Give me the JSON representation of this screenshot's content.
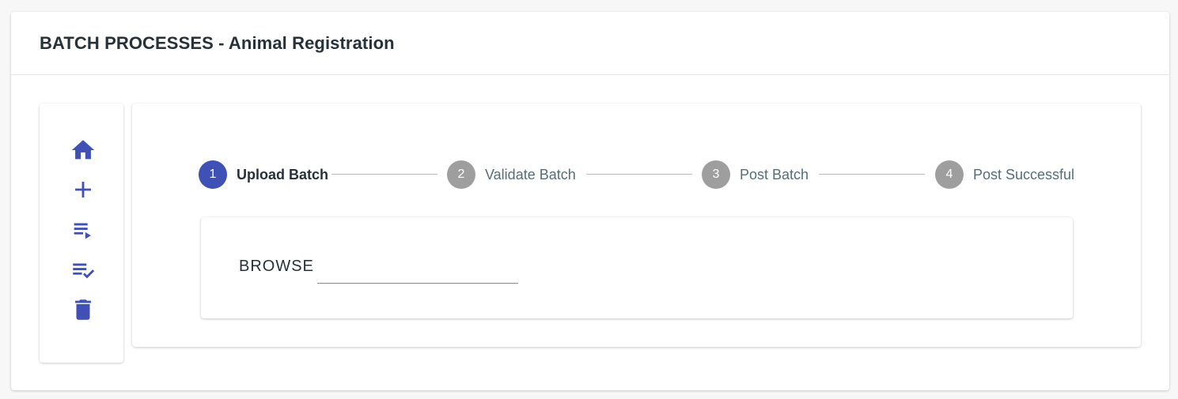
{
  "page": {
    "title": "BATCH PROCESSES - Animal Registration"
  },
  "sidebar": {
    "items": [
      {
        "name": "home-icon"
      },
      {
        "name": "add-icon"
      },
      {
        "name": "playlist-play-icon"
      },
      {
        "name": "playlist-check-icon"
      },
      {
        "name": "delete-icon"
      }
    ],
    "icon_color": "#3f51b5"
  },
  "stepper": {
    "active_color": "#3f51b5",
    "inactive_color": "#9e9e9e",
    "steps": [
      {
        "number": "1",
        "label": "Upload Batch",
        "active": true
      },
      {
        "number": "2",
        "label": "Validate Batch",
        "active": false
      },
      {
        "number": "3",
        "label": "Post Batch",
        "active": false
      },
      {
        "number": "4",
        "label": "Post Successful",
        "active": false
      }
    ]
  },
  "upload": {
    "browse_label": "BROWSE",
    "file_value": ""
  }
}
